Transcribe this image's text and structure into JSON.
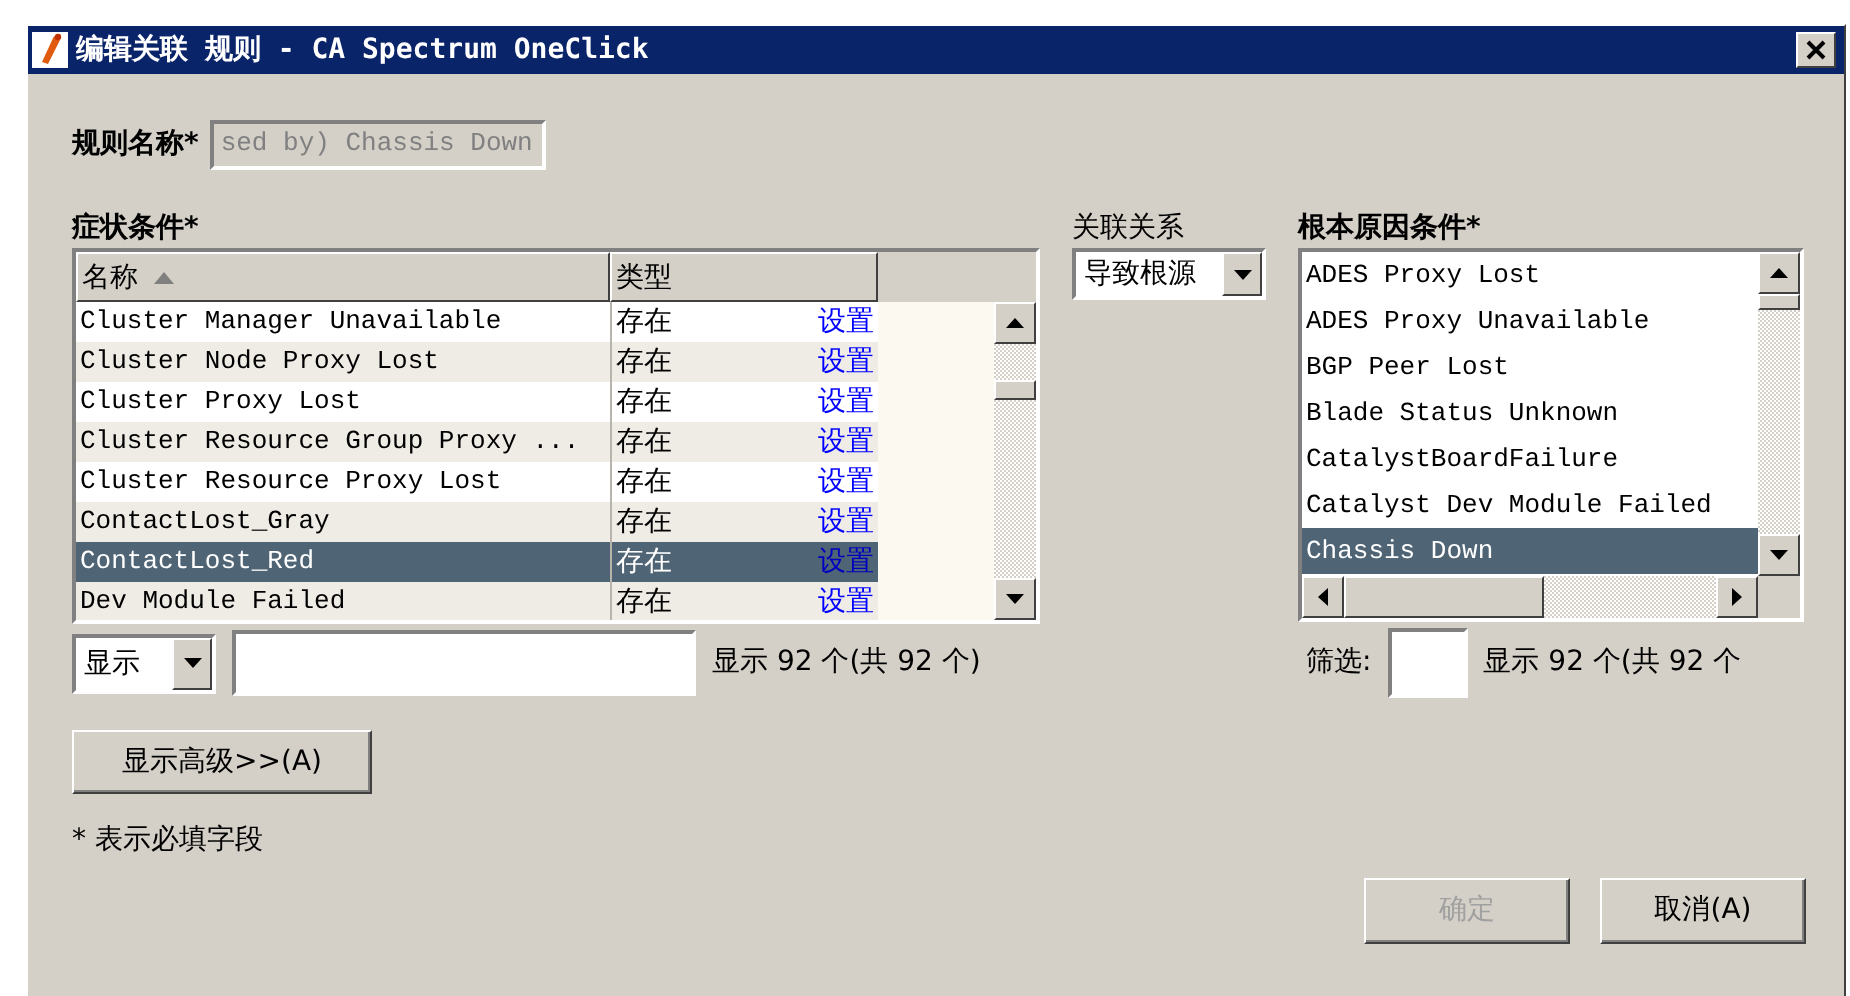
{
  "window": {
    "title": "编辑关联 规则 - CA Spectrum OneClick"
  },
  "rule_name": {
    "label": "规则名称*",
    "value": "sed by) Chassis Down",
    "disabled": true
  },
  "symptoms": {
    "label": "症状条件*",
    "columns": [
      {
        "label": "名称",
        "sorted": true
      },
      {
        "label": "类型",
        "sorted": false
      }
    ],
    "rows": [
      {
        "name": "Cluster Manager Unavailable",
        "type": "存在",
        "action": "设置",
        "selected": false
      },
      {
        "name": "Cluster Node Proxy Lost",
        "type": "存在",
        "action": "设置",
        "selected": false
      },
      {
        "name": "Cluster Proxy Lost",
        "type": "存在",
        "action": "设置",
        "selected": false
      },
      {
        "name": "Cluster Resource Group Proxy ...",
        "type": "存在",
        "action": "设置",
        "selected": false
      },
      {
        "name": "Cluster Resource Proxy Lost",
        "type": "存在",
        "action": "设置",
        "selected": false
      },
      {
        "name": "ContactLost_Gray",
        "type": "存在",
        "action": "设置",
        "selected": false
      },
      {
        "name": "ContactLost_Red",
        "type": "存在",
        "action": "设置",
        "selected": true
      },
      {
        "name": "Dev Module Failed",
        "type": "存在",
        "action": "设置",
        "selected": false
      }
    ],
    "filter_mode": "显示",
    "count": "显示 92 个(共 92 个)"
  },
  "relation": {
    "label": "关联关系",
    "value": "导致根源"
  },
  "root_cause": {
    "label": "根本原因条件*",
    "items": [
      {
        "label": "ADES Proxy Lost",
        "selected": false
      },
      {
        "label": "ADES Proxy Unavailable",
        "selected": false
      },
      {
        "label": "BGP Peer Lost",
        "selected": false
      },
      {
        "label": "Blade Status Unknown",
        "selected": false
      },
      {
        "label": "CatalystBoardFailure",
        "selected": false
      },
      {
        "label": "Catalyst Dev Module Failed",
        "selected": false
      },
      {
        "label": "Chassis Down",
        "selected": true
      }
    ],
    "filter_label": "筛选:",
    "count": "显示 92 个(共 92 个"
  },
  "advanced_button": "显示高级>>(A)",
  "note": "* 表示必填字段",
  "buttons": [
    {
      "label": "确定",
      "disabled": true
    },
    {
      "label": "取消(A)",
      "disabled": false
    }
  ]
}
